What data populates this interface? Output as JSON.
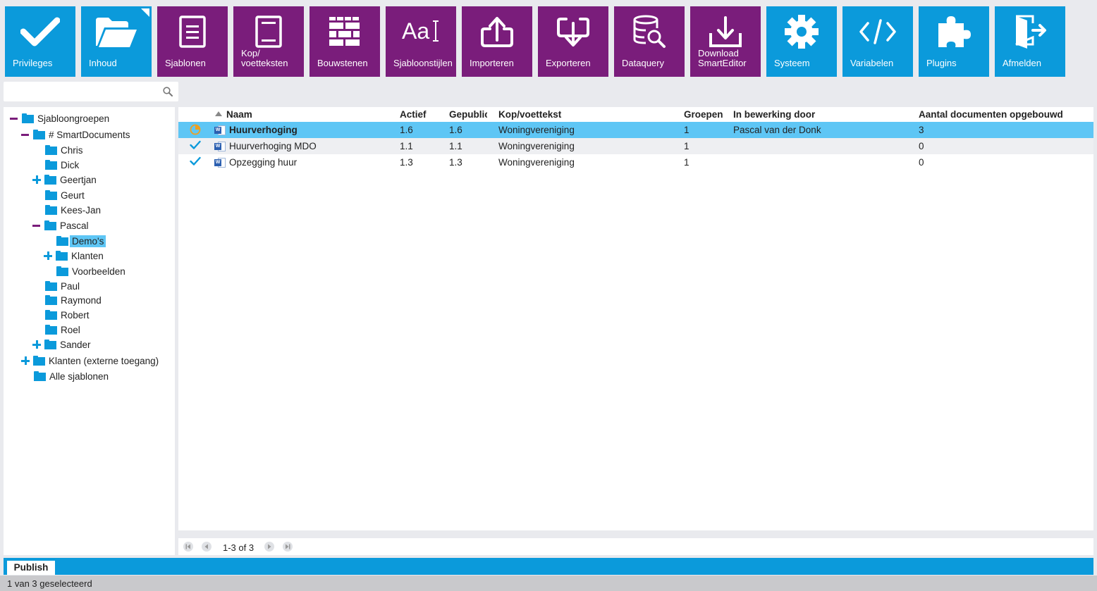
{
  "toolbar": {
    "buttons": [
      {
        "label": "Privileges",
        "icon": "checkmark-icon",
        "color": "#0b9adb"
      },
      {
        "label": "Inhoud",
        "icon": "folder-open-icon",
        "color": "#0b9adb"
      },
      {
        "label": "Sjablonen",
        "icon": "template-document-icon",
        "color": "#7a1d7b"
      },
      {
        "label": "Kop/\nvoetteksten",
        "icon": "header-footer-icon",
        "color": "#7a1d7b"
      },
      {
        "label": "Bouwstenen",
        "icon": "building-blocks-icon",
        "color": "#7a1d7b"
      },
      {
        "label": "Sjabloonstijlen",
        "icon": "text-style-icon",
        "color": "#7a1d7b"
      },
      {
        "label": "Importeren",
        "icon": "import-icon",
        "color": "#7a1d7b"
      },
      {
        "label": "Exporteren",
        "icon": "export-icon",
        "color": "#7a1d7b"
      },
      {
        "label": "Dataquery",
        "icon": "database-search-icon",
        "color": "#7a1d7b"
      },
      {
        "label": "Download\nSmartEditor",
        "icon": "download-icon",
        "color": "#7a1d7b"
      },
      {
        "label": "Systeem",
        "icon": "gear-icon",
        "color": "#0b9adb"
      },
      {
        "label": "Variabelen",
        "icon": "code-icon",
        "color": "#0b9adb"
      },
      {
        "label": "Plugins",
        "icon": "puzzle-icon",
        "color": "#0b9adb"
      },
      {
        "label": "Afmelden",
        "icon": "logout-icon",
        "color": "#0b9adb"
      }
    ]
  },
  "search": {
    "placeholder": "",
    "value": ""
  },
  "tree": {
    "nodes": [
      {
        "label": "Sjabloongroepen",
        "toggle": "minus"
      },
      {
        "label": "# SmartDocuments",
        "toggle": "minus"
      },
      {
        "label": "Chris",
        "toggle": ""
      },
      {
        "label": "Dick",
        "toggle": ""
      },
      {
        "label": "Geertjan",
        "toggle": "plus"
      },
      {
        "label": "Geurt",
        "toggle": ""
      },
      {
        "label": "Kees-Jan",
        "toggle": ""
      },
      {
        "label": "Pascal",
        "toggle": "minus"
      },
      {
        "label": "Demo's",
        "toggle": "",
        "selected": true
      },
      {
        "label": "Klanten",
        "toggle": "plus"
      },
      {
        "label": "Voorbeelden",
        "toggle": ""
      },
      {
        "label": "Paul",
        "toggle": ""
      },
      {
        "label": "Raymond",
        "toggle": ""
      },
      {
        "label": "Robert",
        "toggle": ""
      },
      {
        "label": "Roel",
        "toggle": ""
      },
      {
        "label": "Sander",
        "toggle": "plus"
      },
      {
        "label": "Klanten (externe toegang)",
        "toggle": "plus"
      },
      {
        "label": "Alle sjablonen",
        "toggle": ""
      }
    ]
  },
  "grid": {
    "columns": [
      "Naam",
      "Actief",
      "Gepublic",
      "Kop/voettekst",
      "Groepen",
      "In bewerking door",
      "Aantal documenten opgebouwd"
    ],
    "rows": [
      {
        "status": "in-progress",
        "name": "Huurverhoging",
        "actief": "1.6",
        "gepubliceerd": "1.6",
        "kop": "Woningvereniging",
        "groepen": "1",
        "bewerking": "Pascal van der Donk",
        "aantal": "3",
        "selected": true
      },
      {
        "status": "published",
        "name": "Huurverhoging MDO",
        "actief": "1.1",
        "gepubliceerd": "1.1",
        "kop": "Woningvereniging",
        "groepen": "1",
        "bewerking": "",
        "aantal": "0"
      },
      {
        "status": "published",
        "name": "Opzegging huur",
        "actief": "1.3",
        "gepubliceerd": "1.3",
        "kop": "Woningvereniging",
        "groepen": "1",
        "bewerking": "",
        "aantal": "0"
      }
    ]
  },
  "pager": {
    "text": "1-3 of 3"
  },
  "tabs": [
    {
      "label": "Publish"
    }
  ],
  "status": {
    "text": "1 van 3 geselecteerd"
  },
  "colors": {
    "accent_blue": "#0b9adb",
    "brand_purple": "#7a1d7b",
    "selection": "#5ec6f5",
    "in_progress": "#f0a020"
  }
}
